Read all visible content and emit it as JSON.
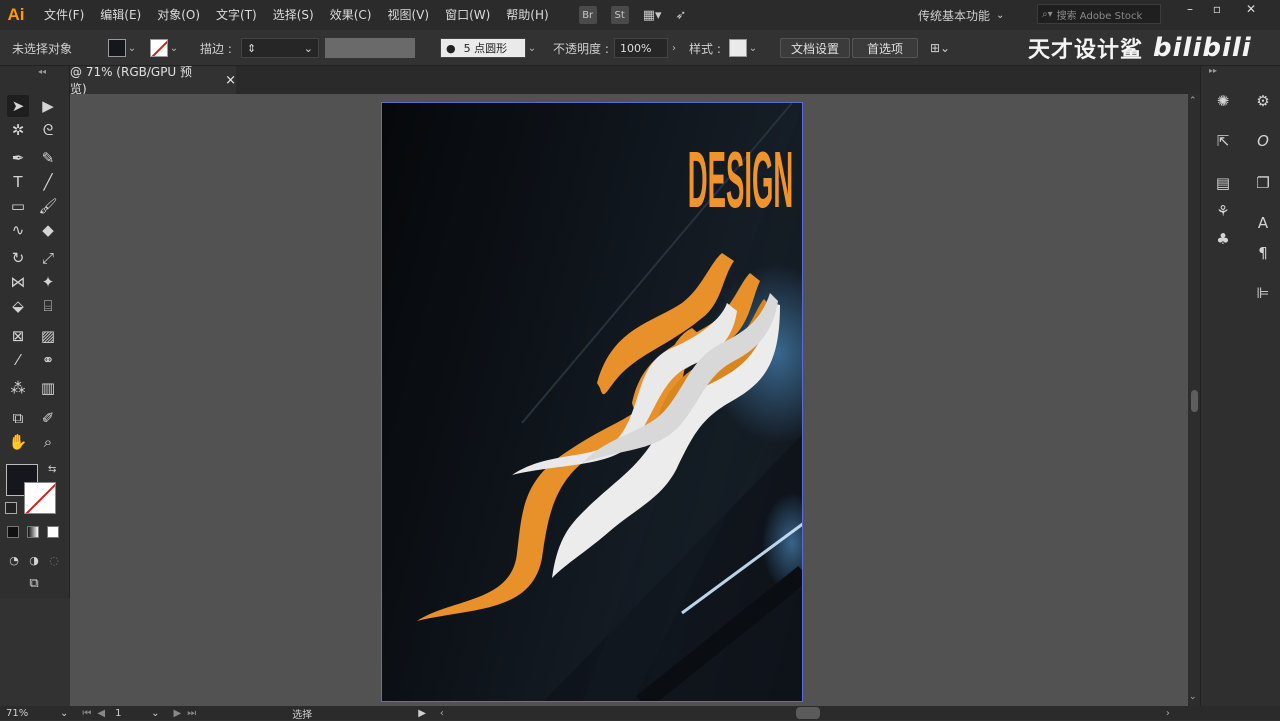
{
  "app": {
    "logo": "Ai",
    "menu": [
      "文件(F)",
      "编辑(E)",
      "对象(O)",
      "文字(T)",
      "选择(S)",
      "效果(C)",
      "视图(V)",
      "窗口(W)",
      "帮助(H)"
    ],
    "menu_icons": [
      "Br",
      "St"
    ],
    "workspace": "传统基本功能",
    "search_placeholder": "搜索 Adobe Stock"
  },
  "control_bar": {
    "selection_label": "未选择对象",
    "stroke_label": "描边 :",
    "brush_label": "5 点圆形",
    "opacity_label": "不透明度 :",
    "opacity_value": "100%",
    "style_label": "样式 :",
    "doc_setup_button": "文档设置",
    "preferences_button": "首选项"
  },
  "watermark": {
    "text": "天才设计鲨",
    "logo": "bilibili"
  },
  "document": {
    "tab_title": "@ 71% (RGB/GPU 预览)",
    "close_symbol": "×",
    "artwork_text": "DESIGN"
  },
  "status": {
    "zoom": "71%",
    "page": "1",
    "mode": "选择"
  },
  "colors": {
    "accent": "#f0932b",
    "fill_color": "#14171c",
    "artboard_border": "#5b6bd8"
  }
}
